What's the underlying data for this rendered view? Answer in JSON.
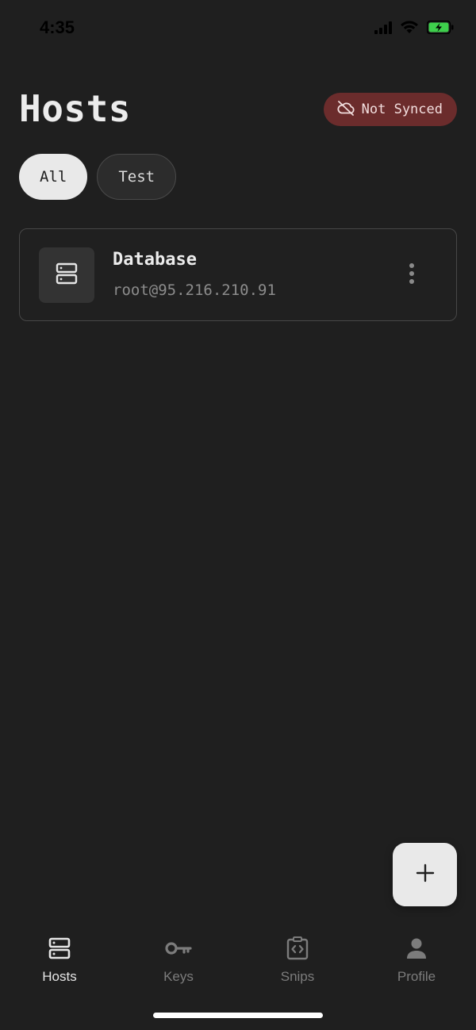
{
  "status_bar": {
    "time": "4:35",
    "icons": [
      "cellular-signal-icon",
      "wifi-icon",
      "battery-charging-icon"
    ],
    "battery_color": "#3ecf4c"
  },
  "header": {
    "title": "Hosts",
    "sync_status": {
      "label": "Not Synced",
      "icon": "cloud-off-icon",
      "color": "#6b2c2c"
    }
  },
  "filters": [
    {
      "label": "All",
      "active": true
    },
    {
      "label": "Test",
      "active": false
    }
  ],
  "hosts": [
    {
      "name": "Database",
      "address": "root@95.216.210.91",
      "icon": "server-icon"
    }
  ],
  "fab": {
    "icon": "plus-icon"
  },
  "bottom_nav": [
    {
      "label": "Hosts",
      "icon": "server-icon",
      "active": true
    },
    {
      "label": "Keys",
      "icon": "key-icon",
      "active": false
    },
    {
      "label": "Snips",
      "icon": "code-clipboard-icon",
      "active": false
    },
    {
      "label": "Profile",
      "icon": "person-icon",
      "active": false
    }
  ]
}
